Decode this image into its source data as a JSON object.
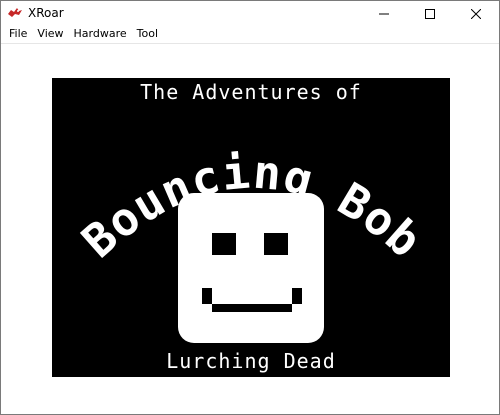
{
  "window": {
    "title": "XRoar",
    "icon": "xroar-dragon-icon",
    "controls": [
      "minimize-icon",
      "maximize-icon",
      "close-icon"
    ]
  },
  "menubar": {
    "items": [
      "File",
      "View",
      "Hardware",
      "Tool"
    ]
  },
  "screen": {
    "heading": "The Adventures of",
    "title": "Bouncing Bob",
    "subtitle": "Lurching Dead",
    "background": "#000000",
    "foreground": "#ffffff"
  }
}
